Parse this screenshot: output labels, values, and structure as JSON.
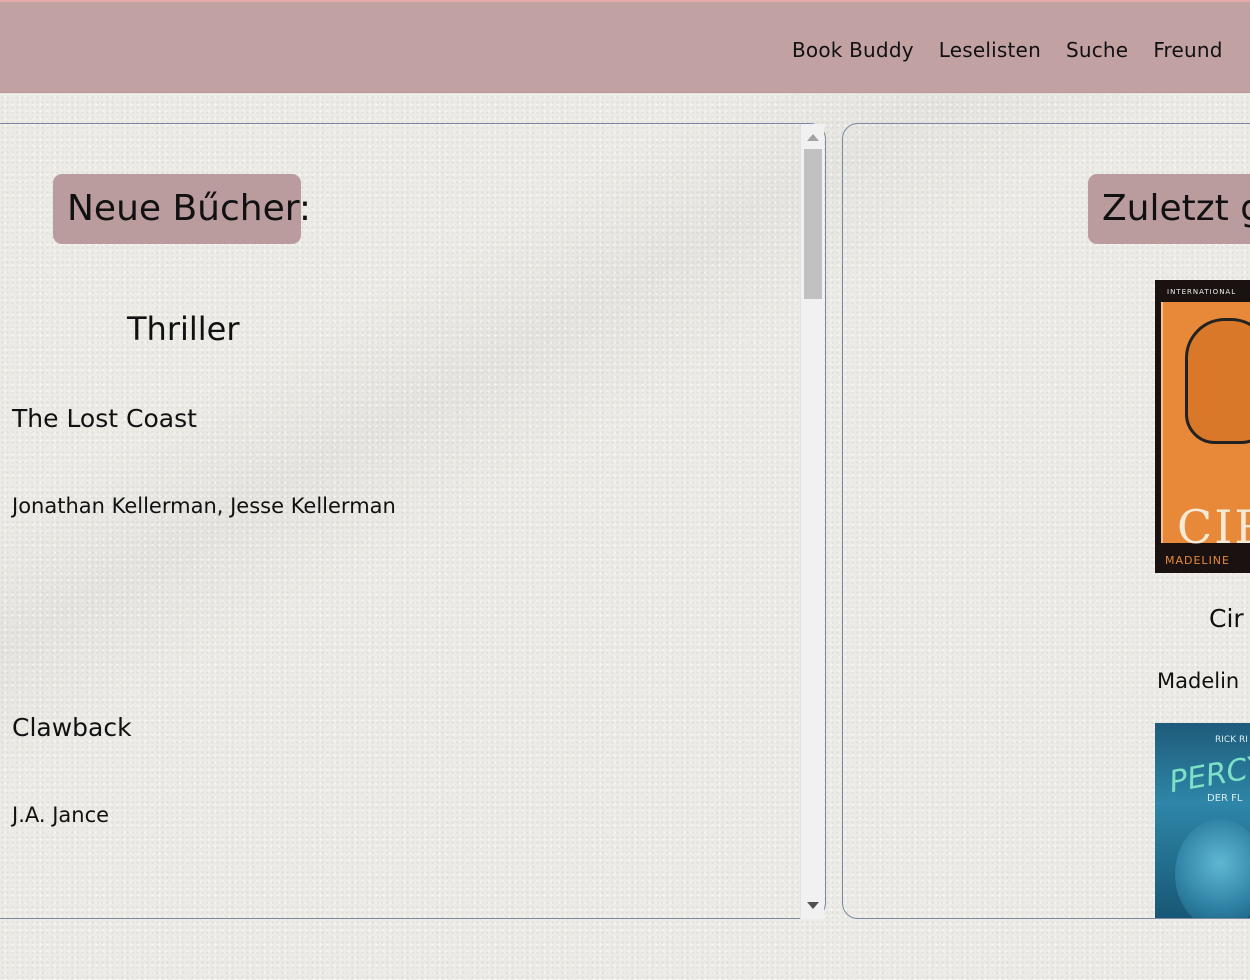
{
  "nav": {
    "items": [
      "Book Buddy",
      "Leselisten",
      "Suche",
      "Freund"
    ]
  },
  "left_panel": {
    "heading": "Neue Bűcher:",
    "genre": "Thriller",
    "books": [
      {
        "title": "The Lost Coast",
        "author": "Jonathan Kellerman, Jesse Kellerman"
      },
      {
        "title": "Clawback",
        "author": "J.A. Jance"
      }
    ]
  },
  "right_panel": {
    "heading": "Zuletzt g",
    "books": [
      {
        "title": "Cir",
        "author": "Madelin",
        "cover_icon": "circe-book-cover",
        "cover_texts": {
          "top": "INTERNATIONAL",
          "word": "CIR",
          "author": "MADELINE"
        }
      },
      {
        "cover_icon": "percy-jackson-book-cover",
        "cover_texts": {
          "top": "RICK RI",
          "word": "PERCY",
          "sub": "DER FL"
        }
      }
    ]
  },
  "colors": {
    "header": "#c1a1a2",
    "pill": "#bb9c9e",
    "panel_border": "#7a8aa2",
    "background": "#ecebe6"
  }
}
